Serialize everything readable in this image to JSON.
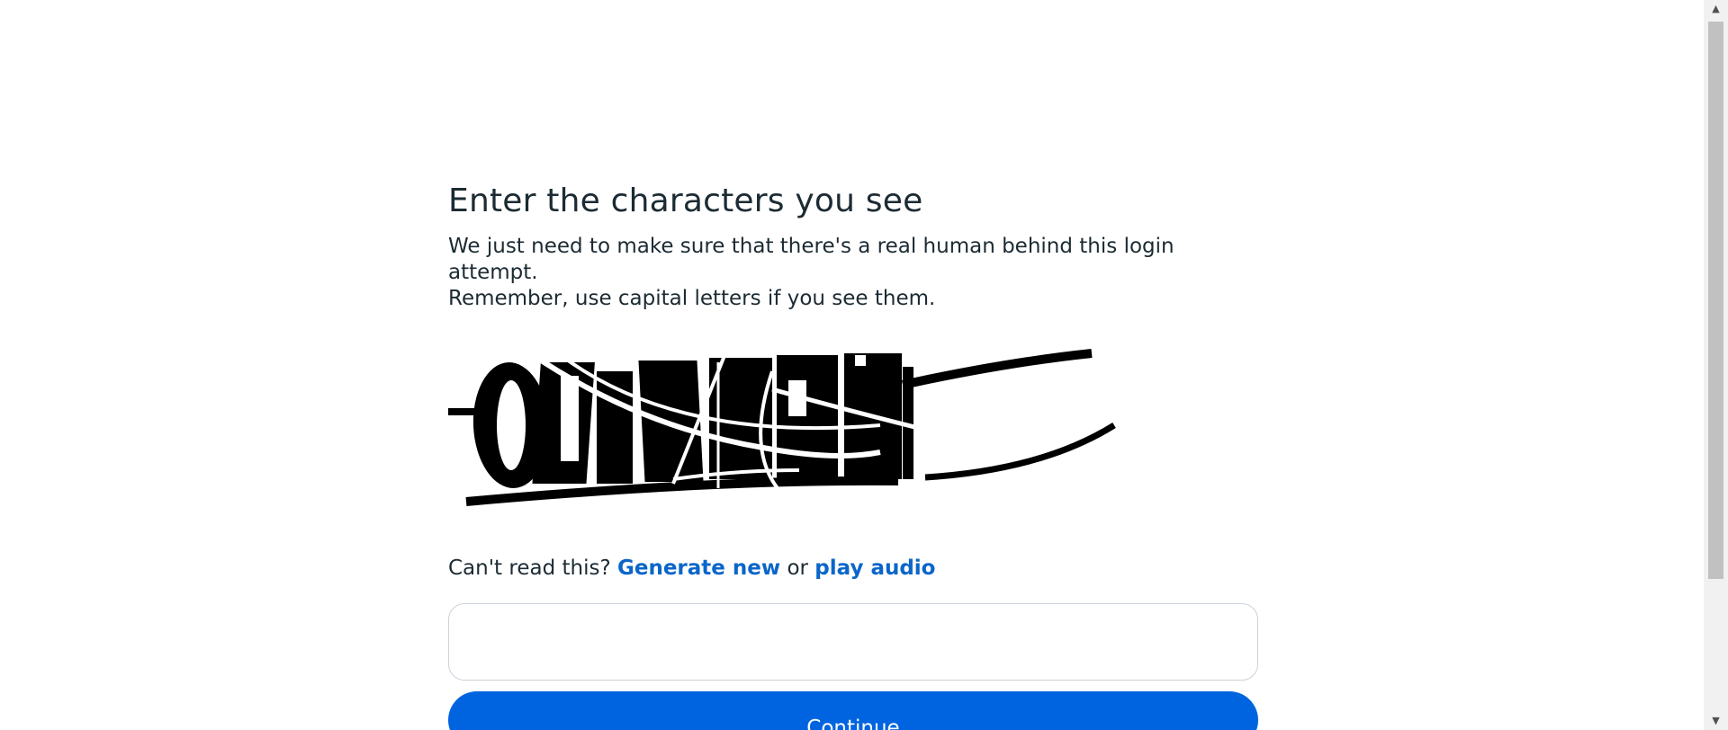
{
  "title": "Enter the characters you see",
  "description_line1": "We just need to make sure that there's a real human behind this login attempt.",
  "description_line2": "Remember, use capital letters if you see them.",
  "captcha": {
    "alt": "captcha image",
    "text": "QU4RJ"
  },
  "help": {
    "prefix": "Can't read this?",
    "generate_new": "Generate new",
    "or": "or",
    "play_audio": "play audio"
  },
  "input": {
    "value": "",
    "placeholder": ""
  },
  "continue_label": "Continue",
  "scrollbar": {
    "up_icon": "scroll-up-arrow-icon",
    "down_icon": "scroll-down-arrow-icon"
  }
}
